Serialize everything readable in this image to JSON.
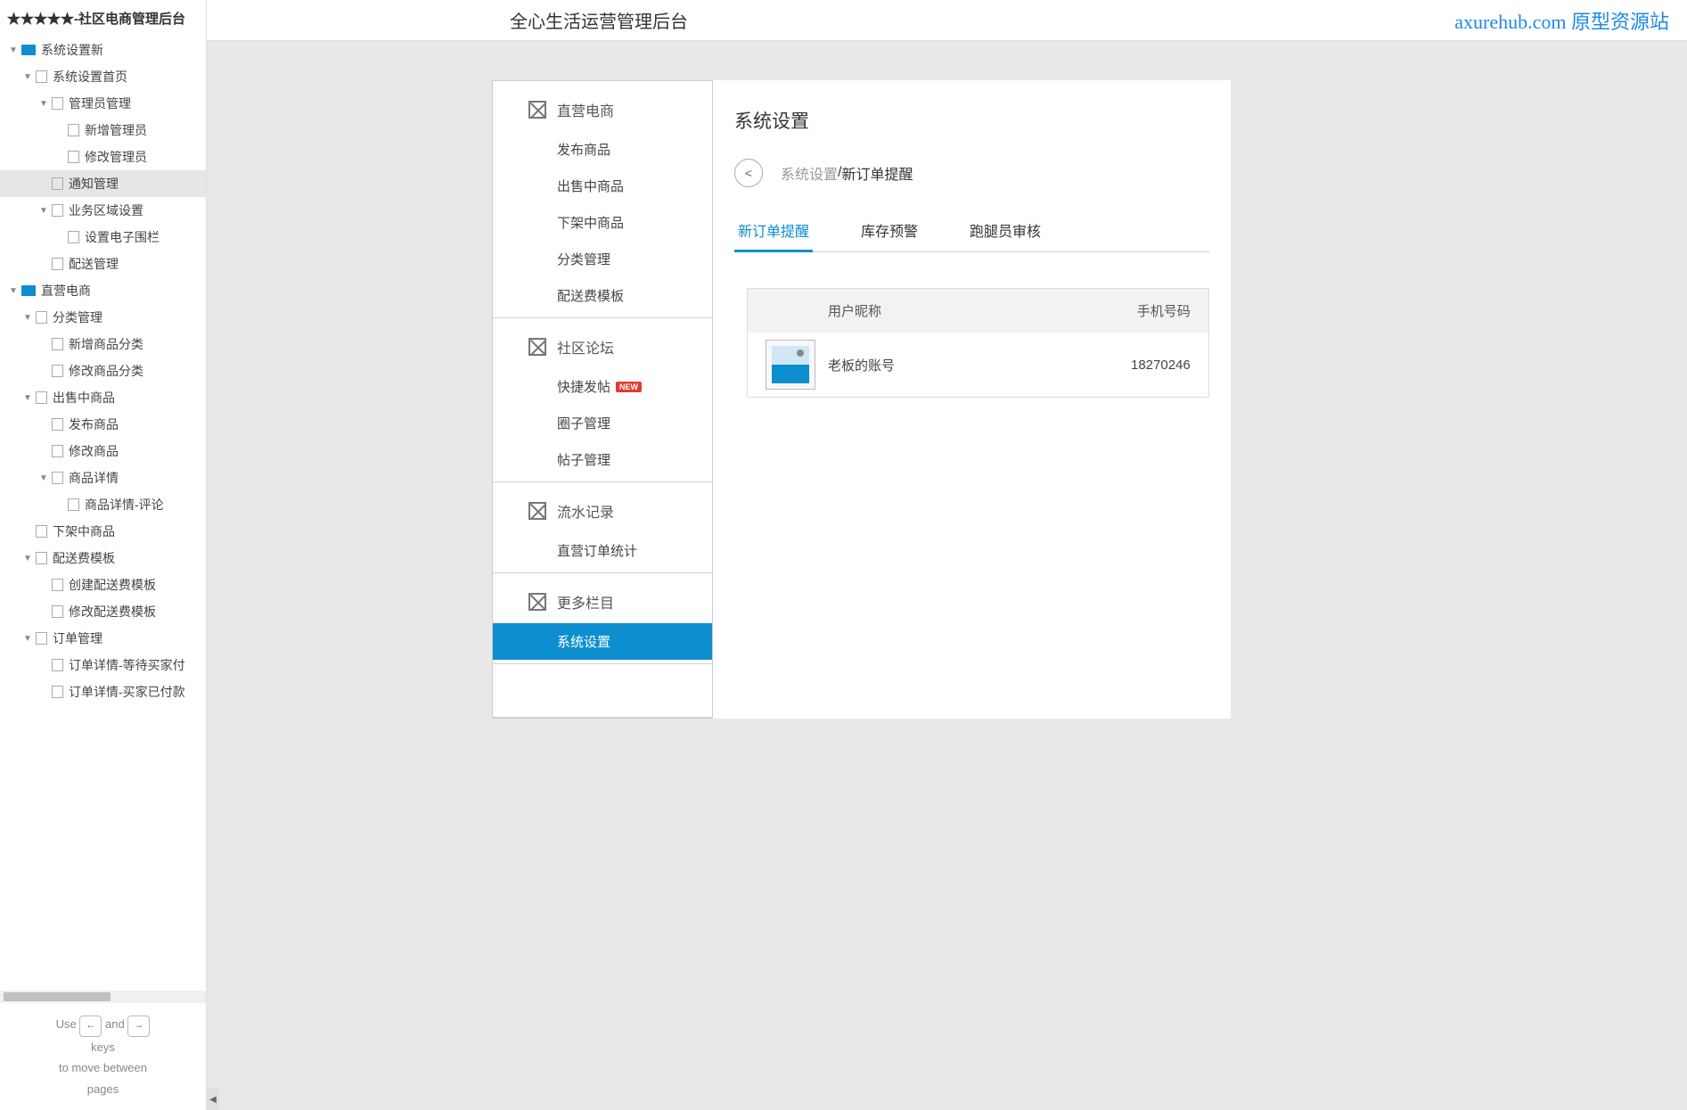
{
  "sidebar": {
    "title": "★★★★★-社区电商管理后台",
    "tree": [
      {
        "label": "系统设置新",
        "type": "folder",
        "indent": 1,
        "caret": true
      },
      {
        "label": "系统设置首页",
        "type": "page",
        "indent": 2,
        "caret": true
      },
      {
        "label": "管理员管理",
        "type": "page",
        "indent": 3,
        "caret": true
      },
      {
        "label": "新增管理员",
        "type": "page",
        "indent": 4
      },
      {
        "label": "修改管理员",
        "type": "page",
        "indent": 4
      },
      {
        "label": "通知管理",
        "type": "page",
        "indent": 3,
        "active": true
      },
      {
        "label": "业务区域设置",
        "type": "page",
        "indent": 3,
        "caret": true
      },
      {
        "label": "设置电子围栏",
        "type": "page",
        "indent": 4
      },
      {
        "label": "配送管理",
        "type": "page",
        "indent": 3
      },
      {
        "label": "直营电商",
        "type": "folder",
        "indent": 1,
        "caret": true
      },
      {
        "label": "分类管理",
        "type": "page",
        "indent": 2,
        "caret": true
      },
      {
        "label": "新增商品分类",
        "type": "page",
        "indent": 3
      },
      {
        "label": "修改商品分类",
        "type": "page",
        "indent": 3
      },
      {
        "label": "出售中商品",
        "type": "page",
        "indent": 2,
        "caret": true
      },
      {
        "label": "发布商品",
        "type": "page",
        "indent": 3
      },
      {
        "label": "修改商品",
        "type": "page",
        "indent": 3
      },
      {
        "label": "商品详情",
        "type": "page",
        "indent": 3,
        "caret": true
      },
      {
        "label": "商品详情-评论",
        "type": "page",
        "indent": 4
      },
      {
        "label": "下架中商品",
        "type": "page",
        "indent": 2
      },
      {
        "label": "配送费模板",
        "type": "page",
        "indent": 2,
        "caret": true
      },
      {
        "label": "创建配送费模板",
        "type": "page",
        "indent": 3
      },
      {
        "label": "修改配送费模板",
        "type": "page",
        "indent": 3
      },
      {
        "label": "订单管理",
        "type": "page",
        "indent": 2,
        "caret": true
      },
      {
        "label": "订单详情-等待买家付",
        "type": "page",
        "indent": 3
      },
      {
        "label": "订单详情-买家已付款",
        "type": "page",
        "indent": 3
      }
    ],
    "navHelp": {
      "use": "Use",
      "and": "and",
      "keys": "keys",
      "move": "to move between",
      "pages": "pages"
    }
  },
  "header": {
    "mainTitle": "全心生活运营管理后台",
    "watermark": "axurehub.com 原型资源站"
  },
  "menu": {
    "sections": [
      {
        "head": "直营电商",
        "items": [
          {
            "label": "发布商品"
          },
          {
            "label": "出售中商品"
          },
          {
            "label": "下架中商品"
          },
          {
            "label": "分类管理"
          },
          {
            "label": "配送费模板"
          }
        ]
      },
      {
        "head": "社区论坛",
        "items": [
          {
            "label": "快捷发帖",
            "badge": "NEW"
          },
          {
            "label": "圈子管理"
          },
          {
            "label": "帖子管理"
          }
        ]
      },
      {
        "head": "流水记录",
        "items": [
          {
            "label": "直营订单统计"
          }
        ]
      },
      {
        "head": "更多栏目",
        "items": [
          {
            "label": "系统设置",
            "active": true
          }
        ]
      }
    ]
  },
  "content": {
    "title": "系统设置",
    "back": "<",
    "breadcrumb": {
      "muted": "系统设置",
      "sep": " /",
      "current": "新订单提醒"
    },
    "tabs": [
      {
        "label": "新订单提醒",
        "active": true
      },
      {
        "label": "库存预警"
      },
      {
        "label": "跑腿员审核"
      }
    ],
    "table": {
      "headers": {
        "nick": "用户昵称",
        "phone": "手机号码"
      },
      "rows": [
        {
          "nick": "老板的账号",
          "phone": "18270246"
        }
      ]
    }
  }
}
